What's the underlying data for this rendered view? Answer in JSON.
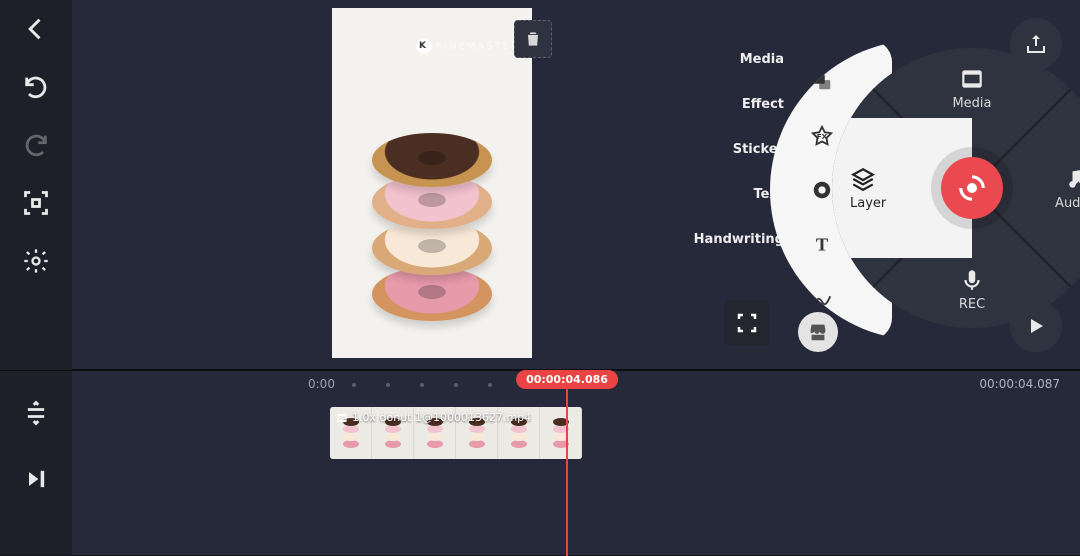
{
  "watermark_text": "KINEMASTER",
  "wheel": {
    "media": "Media",
    "audio": "Audio",
    "rec": "REC",
    "layer": "Layer"
  },
  "layer_submenu": {
    "media": "Media",
    "effect": "Effect",
    "sticker": "Sticker",
    "text": "Text",
    "handwriting": "Handwriting"
  },
  "timeline": {
    "ruler_start": "0:00",
    "playhead_time": "00:00:04.086",
    "end_time": "00:00:04.087",
    "clip_label": "1.0x donut 1@1000013627.mp4"
  },
  "colors": {
    "accent": "#ea4a4f"
  }
}
